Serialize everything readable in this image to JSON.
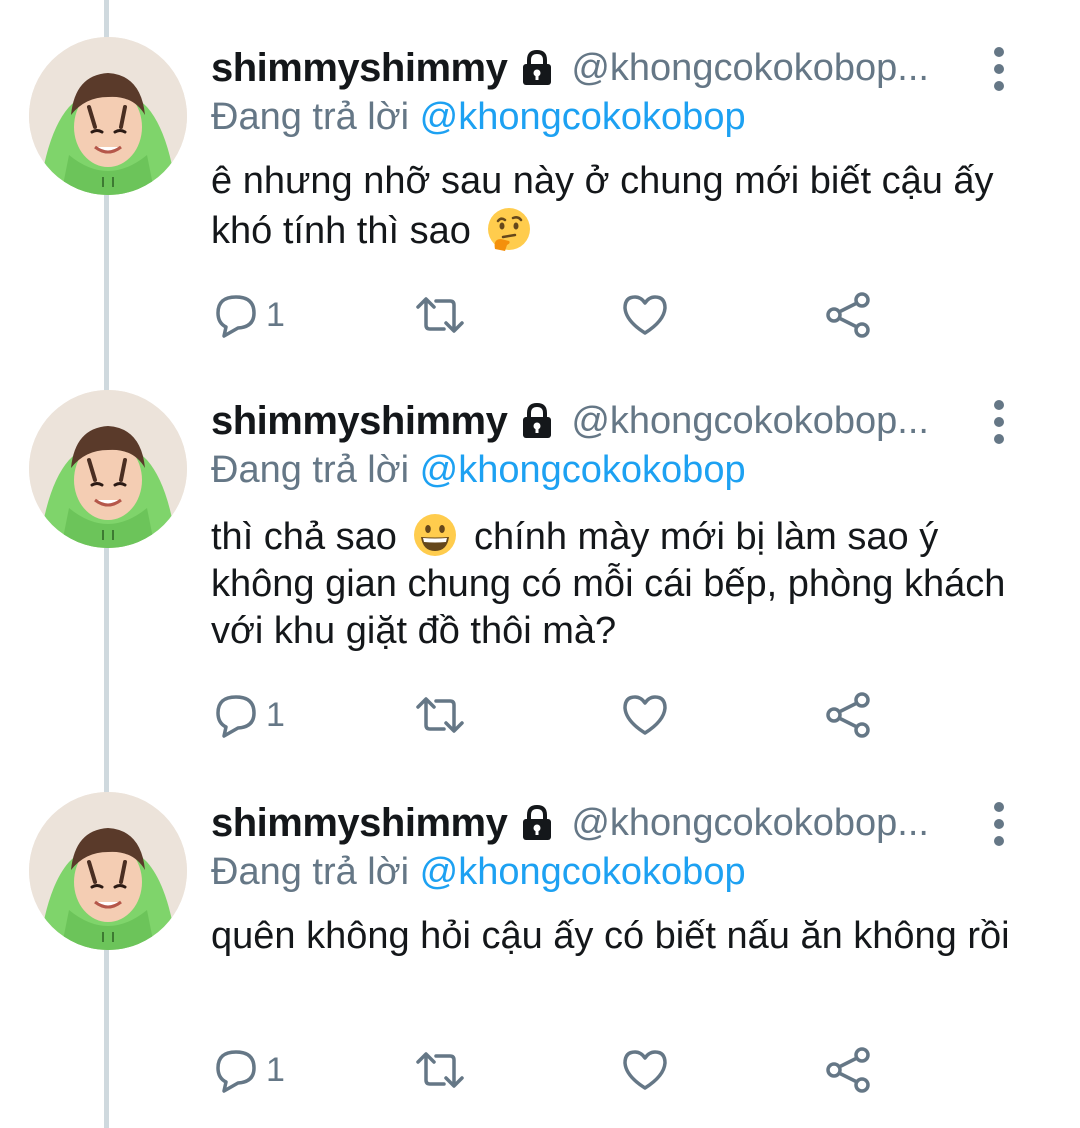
{
  "tweets": [
    {
      "name": "shimmyshimmy",
      "handle": "@khongcokokobop...",
      "reply_prefix": "Đang trả lời",
      "reply_to": "@khongcokokobop",
      "text_before_emoji": "ê nhưng nhỡ sau này ở chung mới biết cậu ấy khó tính thì sao",
      "emoji": "thinking-face",
      "text_after_emoji": "",
      "reply_count": "1"
    },
    {
      "name": "shimmyshimmy",
      "handle": "@khongcokokobop...",
      "reply_prefix": "Đang trả lời",
      "reply_to": "@khongcokokobop",
      "text_before_emoji": "thì chả sao",
      "emoji": "grinning-face",
      "text_after_emoji": "chính mày mới bị làm sao ý không gian chung có mỗi cái bếp, phòng khách với khu giặt đồ thôi mà?",
      "reply_count": "1"
    },
    {
      "name": "shimmyshimmy",
      "handle": "@khongcokokobop...",
      "reply_prefix": "Đang trả lời",
      "reply_to": "@khongcokokobop",
      "text_before_emoji": "quên không hỏi cậu ấy có biết nấu ăn không rồi",
      "emoji": "",
      "text_after_emoji": "",
      "reply_count": "1"
    }
  ],
  "icons": {
    "lock": "lock-icon",
    "more": "more-vertical-icon",
    "reply": "reply-icon",
    "retweet": "retweet-icon",
    "like": "heart-icon",
    "share": "share-icon"
  },
  "colors": {
    "mention": "#1da1f2",
    "secondary_text": "#657786",
    "primary_text": "#14171a",
    "thread_line": "#cfd9de"
  }
}
